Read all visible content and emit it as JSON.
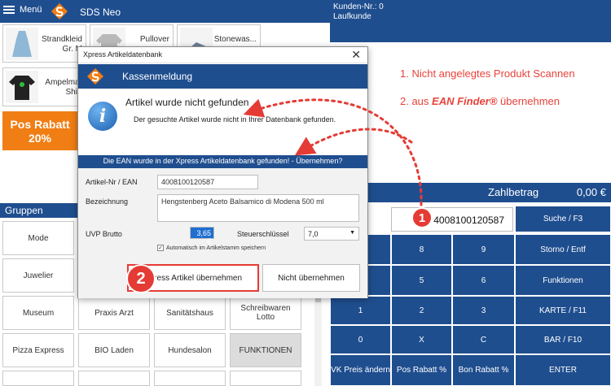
{
  "topbar": {
    "menu_label": "Menü",
    "app_title": "SDS Neo"
  },
  "customer": {
    "line1": "Kunden-Nr.: 0",
    "line2": "Laufkunde"
  },
  "products": [
    {
      "name_line1": "Strandkleid",
      "name_line2": "Gr. M"
    },
    {
      "name_line1": "Pullover",
      "name_line2": ""
    },
    {
      "name_line1": "Stonewas...",
      "name_line2": ""
    },
    {
      "name_line1": "Ampelmar",
      "name_line2": "Shirt"
    }
  ],
  "rabatt": {
    "line1": "Pos Rabatt",
    "line2": "20%"
  },
  "groups": {
    "title": "Gruppen",
    "items": [
      "Mode",
      "Juwelier",
      "Museum",
      "Praxis Arzt",
      "Sanitätshaus",
      "Schreibwaren Lotto",
      "Pizza Express",
      "BIO Laden",
      "Hundesalon",
      "FUNKTIONEN"
    ]
  },
  "payment": {
    "label": "Zahlbetrag",
    "value": "0,00 €"
  },
  "annotations": {
    "step1": "1. Nicht angelegtes Produkt Scannen",
    "step2_prefix": "2. aus ",
    "step2_brand": "EAN Finder®",
    "step2_suffix": " übernehmen"
  },
  "ean_field_value": "4008100120587",
  "keypad": {
    "suche": "Suche / F3",
    "row_storno": [
      "8",
      "9",
      "Storno / Entf"
    ],
    "row_funktionen": [
      "5",
      "6",
      "Funktionen"
    ],
    "row_karte": [
      "1",
      "2",
      "3",
      "KARTE / F11"
    ],
    "row_bar": [
      "0",
      "X",
      "C",
      "BAR / F10"
    ],
    "row_bottom": [
      "VK Preis ändern",
      "Pos Rabatt %",
      "Bon Rabatt %",
      "ENTER"
    ]
  },
  "markers": {
    "one": "1",
    "two": "2"
  },
  "dialog": {
    "window_title": "Xpress Artikeldatenbank",
    "close_glyph": "✕",
    "header": "Kassenmeldung",
    "info_glyph": "i",
    "message_title": "Artikel wurde nicht gefunden",
    "message_sub": "Der gesuchte Artikel wurde nicht in Ihrer Datenbank gefunden.",
    "banner": "Die EAN wurde in der Xpress Artikeldatenbank gefunden! - Übernehmen?",
    "form": {
      "artikel_label": "Artikel-Nr / EAN",
      "artikel_value": "4008100120587",
      "bezeichnung_label": "Bezeichnung",
      "bezeichnung_value": "Hengstenberg Aceto Balsamico di Modena 500 ml",
      "uvp_label": "UVP Brutto",
      "uvp_value": "3,65 €",
      "steuer_label": "Steuerschlüssel",
      "steuer_value": "7,0",
      "auto_label": "Automatisch im Artikelstamm speichern",
      "auto_checked": "✓"
    },
    "btn_accept": "Xpress Artikel übernehmen",
    "btn_reject": "Nicht übernehmen"
  },
  "colors": {
    "brand_blue": "#1f4e8f",
    "accent_red": "#e53b35",
    "orange": "#f07e14"
  }
}
